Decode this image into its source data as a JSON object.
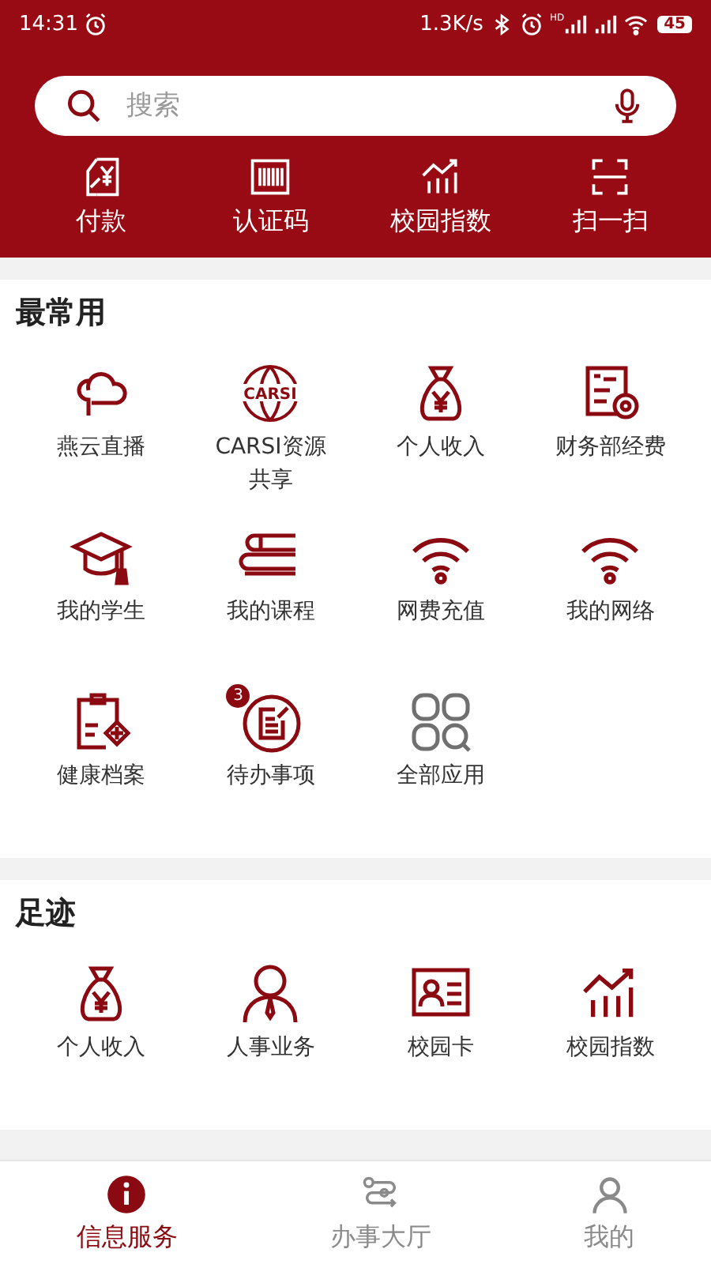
{
  "status_bar": {
    "time": "14:31",
    "speed": "1.3K/s",
    "signal_tag": "HD",
    "battery": "45"
  },
  "search": {
    "placeholder": "搜索"
  },
  "quick_actions": [
    {
      "label": "付款"
    },
    {
      "label": "认证码"
    },
    {
      "label": "校园指数"
    },
    {
      "label": "扫一扫"
    }
  ],
  "sections": [
    {
      "title": "最常用",
      "items": [
        {
          "label": "燕云直播"
        },
        {
          "label": "CARSI资源共享",
          "logo_text": "CARSI"
        },
        {
          "label": "个人收入"
        },
        {
          "label": "财务部经费"
        },
        {
          "label": "我的学生"
        },
        {
          "label": "我的课程"
        },
        {
          "label": "网费充值"
        },
        {
          "label": "我的网络"
        },
        {
          "label": "健康档案"
        },
        {
          "label": "待办事项",
          "badge": "3"
        },
        {
          "label": "全部应用"
        }
      ]
    },
    {
      "title": "足迹",
      "items": [
        {
          "label": "个人收入"
        },
        {
          "label": "人事业务"
        },
        {
          "label": "校园卡"
        },
        {
          "label": "校园指数"
        }
      ]
    }
  ],
  "bottom_nav": [
    {
      "label": "信息服务",
      "selected": true
    },
    {
      "label": "办事大厅",
      "selected": false
    },
    {
      "label": "我的",
      "selected": false
    }
  ]
}
